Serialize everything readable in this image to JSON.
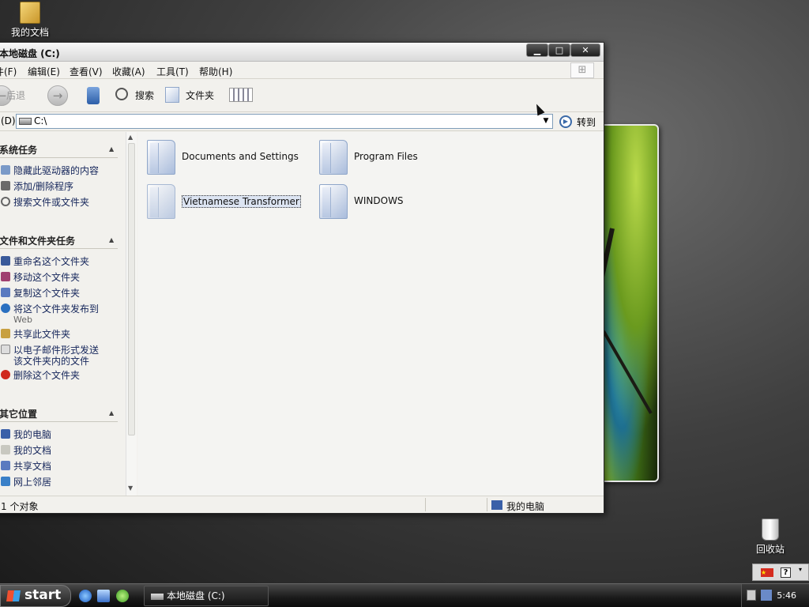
{
  "desktop": {
    "my_documents": "我的文档",
    "recycle_bin": "回收站"
  },
  "window": {
    "title": "本地磁盘 (C:)",
    "menu": [
      "件(F)",
      "编辑(E)",
      "查看(V)",
      "收藏(A)",
      "工具(T)",
      "帮助(H)"
    ],
    "toolbar": {
      "back": "后退",
      "search": "搜索",
      "folders": "文件夹"
    },
    "address": {
      "label": "(D)",
      "value": "C:\\",
      "go": "转到"
    },
    "system_tasks": {
      "header": "系统任务",
      "items": [
        "隐藏此驱动器的内容",
        "添加/删除程序",
        "搜索文件或文件夹"
      ]
    },
    "file_tasks": {
      "header": "文件和文件夹任务",
      "items": [
        "重命名这个文件夹",
        "移动这个文件夹",
        "复制这个文件夹",
        "将这个文件夹发布到",
        "共享此文件夹",
        "以电子邮件形式发送",
        "删除这个文件夹"
      ],
      "publish_sub": "Web",
      "email_line2": "该文件夹内的文件"
    },
    "other_places": {
      "header": "其它位置",
      "items": [
        "我的电脑",
        "我的文档",
        "共享文档",
        "网上邻居"
      ]
    },
    "folders": [
      "Documents and Settings",
      "Program Files",
      "Vietnamese Transformer",
      "WINDOWS"
    ],
    "status": {
      "count": "1 个对象",
      "location": "我的电脑"
    }
  },
  "taskbar": {
    "start": "start",
    "task": "本地磁盘 (C:)",
    "clock": "5:46"
  },
  "colors": {
    "link": "#14255a",
    "titlebar": "#d9d9d9",
    "taskbar": "#1a1a1a"
  }
}
